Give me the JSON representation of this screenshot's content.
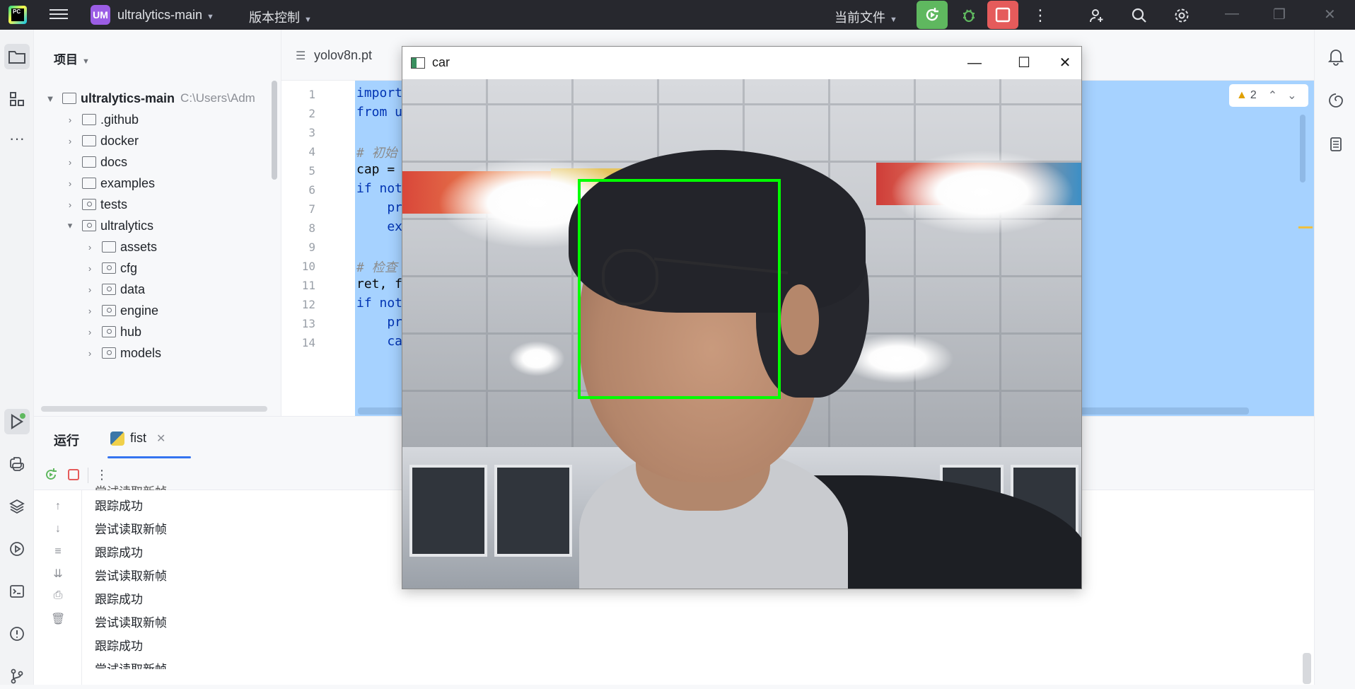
{
  "titlebar": {
    "logo_text": "PC",
    "project_badge": "UM",
    "project_name": "ultralytics-main",
    "vcs_label": "版本控制",
    "current_file_label": "当前文件"
  },
  "project_panel": {
    "header": "项目",
    "tree": [
      {
        "label": "ultralytics-main",
        "path": "C:\\Users\\Adm",
        "level": 0,
        "expanded": true,
        "kind": "folder"
      },
      {
        "label": ".github",
        "level": 1,
        "expanded": false,
        "kind": "folder"
      },
      {
        "label": "docker",
        "level": 1,
        "expanded": false,
        "kind": "folder"
      },
      {
        "label": "docs",
        "level": 1,
        "expanded": false,
        "kind": "folder"
      },
      {
        "label": "examples",
        "level": 1,
        "expanded": false,
        "kind": "folder"
      },
      {
        "label": "tests",
        "level": 1,
        "expanded": false,
        "kind": "package"
      },
      {
        "label": "ultralytics",
        "level": 1,
        "expanded": true,
        "kind": "package"
      },
      {
        "label": "assets",
        "level": 2,
        "expanded": false,
        "kind": "folder"
      },
      {
        "label": "cfg",
        "level": 2,
        "expanded": false,
        "kind": "package"
      },
      {
        "label": "data",
        "level": 2,
        "expanded": false,
        "kind": "package"
      },
      {
        "label": "engine",
        "level": 2,
        "expanded": false,
        "kind": "package"
      },
      {
        "label": "hub",
        "level": 2,
        "expanded": false,
        "kind": "package"
      },
      {
        "label": "models",
        "level": 2,
        "expanded": false,
        "kind": "package"
      }
    ]
  },
  "editor": {
    "tab_label": "yolov8n.pt",
    "warning_count": "2",
    "line_numbers": [
      "1",
      "2",
      "3",
      "4",
      "5",
      "6",
      "7",
      "8",
      "9",
      "10",
      "11",
      "12",
      "13",
      "14"
    ],
    "lines": [
      {
        "a": "import",
        "b": "",
        "cls": "kw"
      },
      {
        "a": "from u",
        "b": "",
        "cls": "kw"
      },
      {
        "a": "",
        "b": "",
        "cls": ""
      },
      {
        "a": "# 初始",
        "b": "",
        "cls": "cm"
      },
      {
        "a": "cap = ",
        "b": "",
        "cls": ""
      },
      {
        "a": "if not",
        "b": "",
        "cls": "kw"
      },
      {
        "a": "    pr",
        "b": "",
        "cls": "kw"
      },
      {
        "a": "    ex",
        "b": "",
        "cls": "kw"
      },
      {
        "a": "",
        "b": "",
        "cls": ""
      },
      {
        "a": "# 检查",
        "b": "",
        "cls": "cm"
      },
      {
        "a": "ret, f",
        "b": "",
        "cls": ""
      },
      {
        "a": "if not",
        "b": "",
        "cls": "kw"
      },
      {
        "a": "    pr",
        "b": "",
        "cls": "kw"
      },
      {
        "a": "    ca",
        "b": "",
        "cls": "kw"
      }
    ]
  },
  "run_panel": {
    "title": "运行",
    "tab_label": "fist",
    "output": [
      "尝试读取新帧",
      "跟踪成功",
      "尝试读取新帧",
      "跟踪成功",
      "尝试读取新帧",
      "跟踪成功",
      "尝试读取新帧",
      "跟踪成功",
      "尝试读取新帧"
    ]
  },
  "cv_window": {
    "title": "car",
    "bbox_color": "#00ff00"
  },
  "colors": {
    "accent": "#3574f0",
    "selection": "#a6d2ff",
    "run_green": "#5fb85f",
    "stop_red": "#e55b5b"
  }
}
